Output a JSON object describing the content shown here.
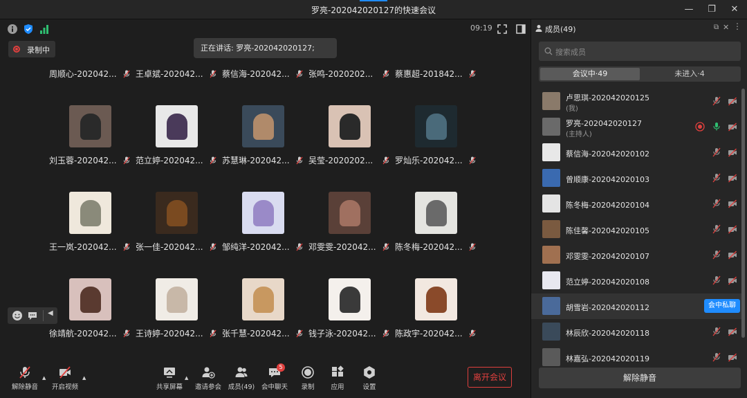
{
  "window": {
    "title": "罗亮-202042020127的快速会议"
  },
  "topbar": {
    "clock": "09:19"
  },
  "recording": {
    "label": "录制中"
  },
  "speaking": {
    "text": "正在讲话: 罗亮-202042020127;"
  },
  "grid": {
    "row0": [
      "周顺心-202042...",
      "王卓斌-202042...",
      "蔡信海-202042...",
      "张鸣-2020202...",
      "蔡惠超-201842..."
    ],
    "row1": [
      "刘玉蓉-202042...",
      "范立婷-202042...",
      "苏慧琳-202042...",
      "吴莹-2020202...",
      "罗灿乐-202042..."
    ],
    "row2": [
      "王一岚-202042...",
      "张一佳-202042...",
      "邹纯洋-202042...",
      "邓雯雯-202042...",
      "陈冬梅-202042..."
    ],
    "row3": [
      "徐靖航-202042...",
      "王诗婷-202042...",
      "张千慧-202042...",
      "钱子泳-202042...",
      "陈政宇-202042..."
    ]
  },
  "toolbar": {
    "unmute": "解除静音",
    "video": "开启视频",
    "share": "共享屏幕",
    "invite": "邀请参会",
    "members": "成员(49)",
    "chat": "会中聊天",
    "chat_badge": "5",
    "record": "录制",
    "apps": "应用",
    "settings": "设置",
    "leave": "离开会议"
  },
  "panel": {
    "title": "成员(49)",
    "search_placeholder": "搜索成员",
    "tab_in": "会议中·49",
    "tab_out": "未进入·4",
    "members": [
      {
        "name": "卢思琪-202042020125",
        "sub": "(我)"
      },
      {
        "name": "罗亮-202042020127",
        "sub": "(主持人)"
      },
      {
        "name": "蔡信海-202042020102"
      },
      {
        "name": "曾顺康-202042020103"
      },
      {
        "name": "陈冬梅-202042020104"
      },
      {
        "name": "陈佳馨-202042020105"
      },
      {
        "name": "邓雯雯-202042020107"
      },
      {
        "name": "范立婷-202042020108"
      },
      {
        "name": "胡雪岩-202042020112"
      },
      {
        "name": "林辰欣-202042020118"
      },
      {
        "name": "林嘉弘-202042020119"
      }
    ],
    "private_chat": "会中私聊",
    "unmute_all": "解除静音"
  },
  "colors": {
    "accent": "#1f8cff",
    "danger": "#e0403e",
    "mic_on": "#2fbf71"
  }
}
